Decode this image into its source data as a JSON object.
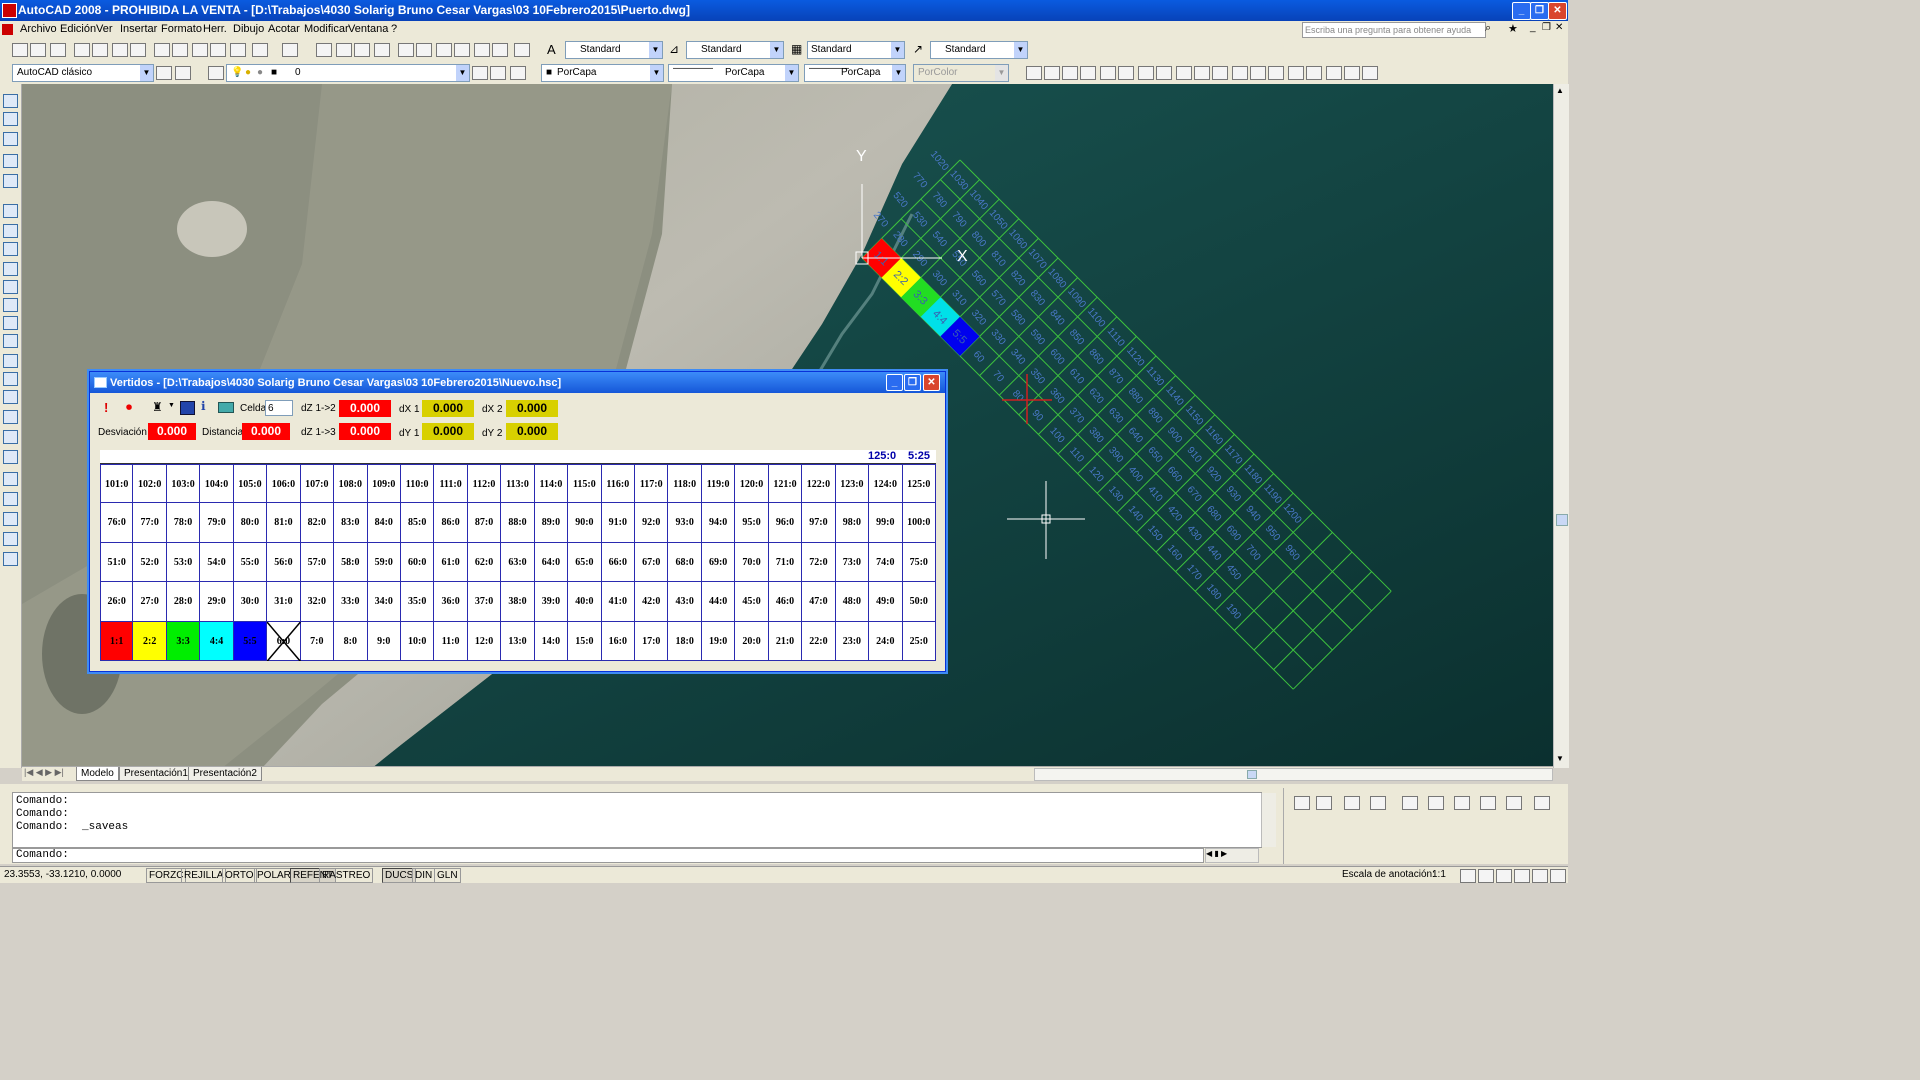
{
  "window": {
    "title": "AutoCAD 2008 - PROHIBIDA LA VENTA - [D:\\Trabajos\\4030 Solarig Bruno Cesar Vargas\\03 10Febrero2015\\Puerto.dwg]"
  },
  "menu": {
    "items": [
      "Archivo",
      "Edición",
      "Ver",
      "Insertar",
      "Formato",
      "Herr.",
      "Dibujo",
      "Acotar",
      "Modificar",
      "Ventana",
      "?"
    ],
    "help_placeholder": "Escriba una pregunta para obtener ayuda"
  },
  "toolbar_styles": {
    "text_style": "Standard",
    "dim_style": "Standard",
    "table_style": "Standard",
    "mleader_style": "Standard"
  },
  "toolbar_layers": {
    "workspace": "AutoCAD clásico",
    "layer": "0",
    "color": "PorCapa",
    "linetype": "PorCapa",
    "lineweight": "PorCapa",
    "plotstyle": "PorColor"
  },
  "drawing": {
    "ucs_y": "Y",
    "ucs_x": "X",
    "colors": {
      "sea": "#0e3a3e",
      "sand": "#b8b4a8",
      "grid_line": "#3ec23e",
      "label": "#4a78c8"
    },
    "colored_cells": [
      {
        "label": "1:1",
        "color": "#ff0000"
      },
      {
        "label": "2:2",
        "color": "#ffff00"
      },
      {
        "label": "3:3",
        "color": "#22dd22"
      },
      {
        "label": "4:4",
        "color": "#00e0e8"
      },
      {
        "label": "5:5",
        "color": "#0000ee"
      }
    ],
    "col_labels": [
      [
        "1010",
        "1020",
        "1030",
        "1040",
        "1050",
        "1060",
        "1070",
        "1080",
        "1090",
        "1100",
        "1110",
        "1120",
        "1130",
        "1140",
        "1150",
        "1160",
        "1170",
        "1180",
        "1190",
        "1200"
      ],
      [
        "760",
        "770",
        "780",
        "790",
        "800",
        "810",
        "820",
        "830",
        "840",
        "850",
        "860",
        "870",
        "880",
        "890",
        "900",
        "910",
        "920",
        "930",
        "940",
        "950",
        "960"
      ],
      [
        "510",
        "520",
        "530",
        "540",
        "550",
        "560",
        "570",
        "580",
        "590",
        "600",
        "610",
        "620",
        "630",
        "640",
        "650",
        "660",
        "670",
        "680",
        "690",
        "700"
      ],
      [
        "260",
        "270",
        "280",
        "290",
        "300",
        "310",
        "320",
        "330",
        "340",
        "350",
        "360",
        "370",
        "380",
        "390",
        "400",
        "410",
        "420",
        "430",
        "440",
        "450"
      ],
      [
        "60",
        "70",
        "80",
        "90",
        "100",
        "110",
        "120",
        "130",
        "140",
        "150",
        "160",
        "170",
        "180",
        "190"
      ]
    ]
  },
  "tabs": [
    "Modelo",
    "Presentación1",
    "Presentación2"
  ],
  "command": {
    "lines": [
      "Comando:",
      "Comando:",
      "Comando:  _saveas"
    ],
    "prompt": "Comando:"
  },
  "status": {
    "coords": "23.3553, -33.1210, 0.0000",
    "toggles": [
      "FORZC",
      "REJILLA",
      "ORTO",
      "POLAR",
      "REFENT",
      "RASTREO",
      "DUCS",
      "DIN",
      "GLN"
    ],
    "toggles_on": [
      "REFENT",
      "DUCS"
    ],
    "annotation_label": "Escala de anotación:",
    "annotation_scale": "1:1"
  },
  "dialog": {
    "title": "Vertidos - [D:\\Trabajos\\4030 Solarig Bruno Cesar Vargas\\03 10Febrero2015\\Nuevo.hsc]",
    "celda_label": "Celda",
    "celda_value": "6",
    "dz12_label": "dZ 1->2",
    "dz12_value": "0.000",
    "dx1_label": "dX 1",
    "dx1_value": "0.000",
    "dx2_label": "dX 2",
    "dx2_value": "0.000",
    "desviacion_label": "Desviación",
    "desviacion_value": "0.000",
    "distancia_label": "Distancia",
    "distancia_value": "0.000",
    "dz13_label": "dZ 1->3",
    "dz13_value": "0.000",
    "dy1_label": "dY 1",
    "dy1_value": "0.000",
    "dy2_label": "dY 2",
    "dy2_value": "0.000",
    "grid_info_left": "125:0",
    "grid_info_right": "5:25",
    "grid_rows": [
      [
        "101:0",
        "102:0",
        "103:0",
        "104:0",
        "105:0",
        "106:0",
        "107:0",
        "108:0",
        "109:0",
        "110:0",
        "111:0",
        "112:0",
        "113:0",
        "114:0",
        "115:0",
        "116:0",
        "117:0",
        "118:0",
        "119:0",
        "120:0",
        "121:0",
        "122:0",
        "123:0",
        "124:0",
        "125:0"
      ],
      [
        "76:0",
        "77:0",
        "78:0",
        "79:0",
        "80:0",
        "81:0",
        "82:0",
        "83:0",
        "84:0",
        "85:0",
        "86:0",
        "87:0",
        "88:0",
        "89:0",
        "90:0",
        "91:0",
        "92:0",
        "93:0",
        "94:0",
        "95:0",
        "96:0",
        "97:0",
        "98:0",
        "99:0",
        "100:0"
      ],
      [
        "51:0",
        "52:0",
        "53:0",
        "54:0",
        "55:0",
        "56:0",
        "57:0",
        "58:0",
        "59:0",
        "60:0",
        "61:0",
        "62:0",
        "63:0",
        "64:0",
        "65:0",
        "66:0",
        "67:0",
        "68:0",
        "69:0",
        "70:0",
        "71:0",
        "72:0",
        "73:0",
        "74:0",
        "75:0"
      ],
      [
        "26:0",
        "27:0",
        "28:0",
        "29:0",
        "30:0",
        "31:0",
        "32:0",
        "33:0",
        "34:0",
        "35:0",
        "36:0",
        "37:0",
        "38:0",
        "39:0",
        "40:0",
        "41:0",
        "42:0",
        "43:0",
        "44:0",
        "45:0",
        "46:0",
        "47:0",
        "48:0",
        "49:0",
        "50:0"
      ],
      [
        "1:1",
        "2:2",
        "3:3",
        "4:4",
        "5:5",
        "6:0",
        "7:0",
        "8:0",
        "9:0",
        "10:0",
        "11:0",
        "12:0",
        "13:0",
        "14:0",
        "15:0",
        "16:0",
        "17:0",
        "18:0",
        "19:0",
        "20:0",
        "21:0",
        "22:0",
        "23:0",
        "24:0",
        "25:0"
      ]
    ],
    "cell_colors": {
      "1:1": "#ff0000",
      "2:2": "#ffff00",
      "3:3": "#00ee00",
      "4:4": "#00ffff",
      "5:5": "#0000ff"
    },
    "crossed_cell": "6:0"
  }
}
